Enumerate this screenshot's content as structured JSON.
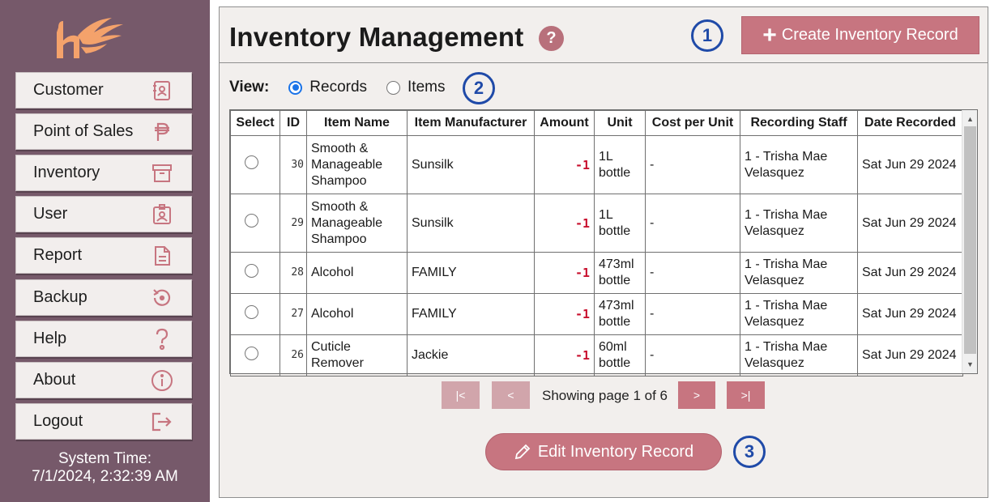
{
  "sidebar": {
    "items": [
      {
        "label": "Customer",
        "icon": "contact-book-icon"
      },
      {
        "label": "Point of Sales",
        "icon": "peso-icon"
      },
      {
        "label": "Inventory",
        "icon": "archive-box-icon"
      },
      {
        "label": "User",
        "icon": "id-badge-icon"
      },
      {
        "label": "Report",
        "icon": "document-icon"
      },
      {
        "label": "Backup",
        "icon": "restore-icon"
      },
      {
        "label": "Help",
        "icon": "question-icon"
      },
      {
        "label": "About",
        "icon": "info-icon"
      },
      {
        "label": "Logout",
        "icon": "logout-icon"
      }
    ],
    "system_time_label": "System Time:",
    "system_time_value": "7/1/2024, 2:32:39 AM"
  },
  "header": {
    "title": "Inventory Management",
    "help_label": "?",
    "create_button": "Create Inventory Record",
    "step1": "1"
  },
  "view": {
    "label": "View:",
    "options": [
      "Records",
      "Items"
    ],
    "selected": "Records",
    "step2": "2"
  },
  "table": {
    "columns": [
      "Select",
      "ID",
      "Item Name",
      "Item Manufacturer",
      "Amount",
      "Unit",
      "Cost per Unit",
      "Recording Staff",
      "Date Recorded"
    ],
    "rows": [
      {
        "id": "30",
        "item_name": "Smooth & Manageable Shampoo",
        "manufacturer": "Sunsilk",
        "amount": "-1",
        "unit": "1L bottle",
        "cost": "-",
        "staff": "1 - Trisha Mae Velasquez",
        "date": "Sat Jun 29 2024"
      },
      {
        "id": "29",
        "item_name": "Smooth & Manageable Shampoo",
        "manufacturer": "Sunsilk",
        "amount": "-1",
        "unit": "1L bottle",
        "cost": "-",
        "staff": "1 - Trisha Mae Velasquez",
        "date": "Sat Jun 29 2024"
      },
      {
        "id": "28",
        "item_name": "Alcohol",
        "manufacturer": "FAMILY",
        "amount": "-1",
        "unit": "473ml bottle",
        "cost": "-",
        "staff": "1 - Trisha Mae Velasquez",
        "date": "Sat Jun 29 2024"
      },
      {
        "id": "27",
        "item_name": "Alcohol",
        "manufacturer": "FAMILY",
        "amount": "-1",
        "unit": "473ml bottle",
        "cost": "-",
        "staff": "1 - Trisha Mae Velasquez",
        "date": "Sat Jun 29 2024"
      },
      {
        "id": "26",
        "item_name": "Cuticle Remover",
        "manufacturer": "Jackie",
        "amount": "-1",
        "unit": "60ml bottle",
        "cost": "-",
        "staff": "1 - Trisha Mae Velasquez",
        "date": "Sat Jun 29 2024"
      }
    ]
  },
  "pagination": {
    "first": "|<",
    "prev": "<",
    "status": "Showing page 1 of 6",
    "next": ">",
    "last": ">|"
  },
  "edit_button": "Edit Inventory Record",
  "step3": "3",
  "colors": {
    "sidebar": "#76596a",
    "accent": "#c77580",
    "accent_disabled": "#d1a5ab",
    "step_blue": "#1f4aa8",
    "negative_amount": "#c8102e",
    "logo": "#f4a26b"
  }
}
